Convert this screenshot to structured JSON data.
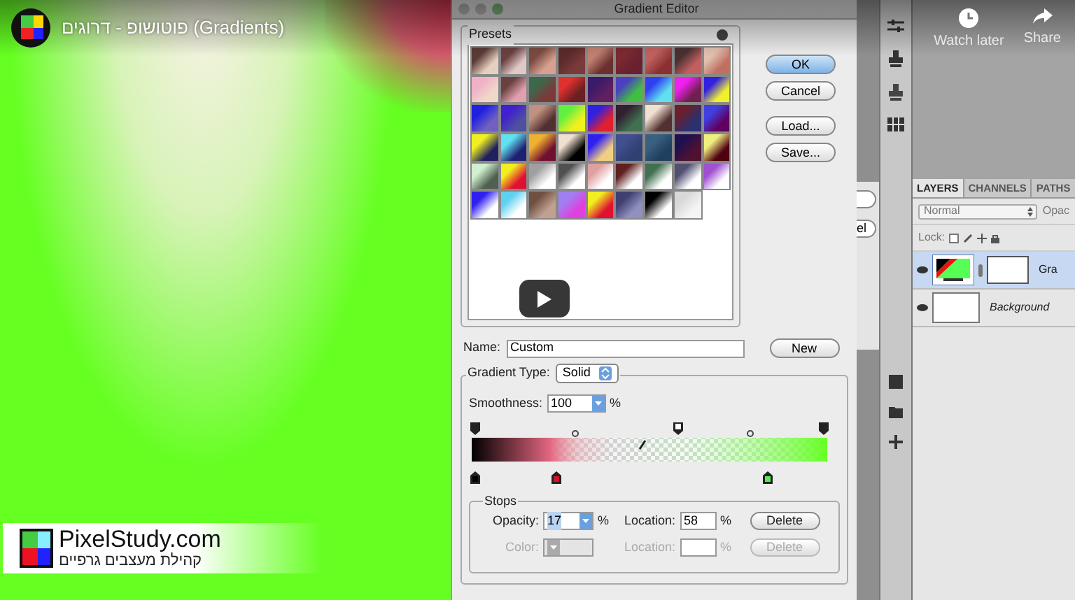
{
  "video_title": "פוטושופ - דרוגים (Gradients)",
  "video_actions": [
    {
      "label": "Watch later",
      "kind": "clock"
    },
    {
      "label": "Share",
      "kind": "share"
    }
  ],
  "overlay_logo": {
    "title": "PixelStudy.com",
    "subtitle": "קהילת מעצבים גרפיים"
  },
  "gradient_editor": {
    "title": "Gradient Editor",
    "presets_label": "Presets",
    "buttons": [
      {
        "label": "OK",
        "default": true
      },
      {
        "label": "Cancel",
        "default": false
      },
      {
        "label": "Load...",
        "default": false
      },
      {
        "label": "Save...",
        "default": false
      }
    ],
    "name_label": "Name:",
    "name_value": "Custom",
    "new_button": "New",
    "gradient_type_label": "Gradient Type:",
    "gradient_type": "Solid",
    "smoothness_label": "Smoothness:",
    "smoothness": "100",
    "smoothness_unit": "%",
    "stops_label": "Stops",
    "stop_rows": [
      {
        "label": "Opacity:",
        "value": "17",
        "unit": "%",
        "location_label": "Location:",
        "location": "58",
        "location_unit": "%",
        "button": "Delete",
        "disabled": false
      },
      {
        "label": "Color:",
        "location_label": "Location:",
        "location_unit": "%",
        "button": "Delete",
        "disabled": true
      }
    ]
  },
  "background_dialog": {
    "buttons": [
      "el"
    ]
  },
  "layers_panel": {
    "tabs": [
      {
        "label": "LAYERS",
        "selected": true
      },
      {
        "label": "CHANNELS",
        "selected": false
      },
      {
        "label": "PATHS",
        "selected": false
      }
    ],
    "blend_mode": "Normal",
    "opacity_label": "Opac",
    "lock_label": "Lock:",
    "layers": [
      {
        "name": "Gra",
        "kind": "gradient",
        "selected": true
      },
      {
        "name": "Background",
        "kind": "background",
        "selected": false
      }
    ]
  }
}
